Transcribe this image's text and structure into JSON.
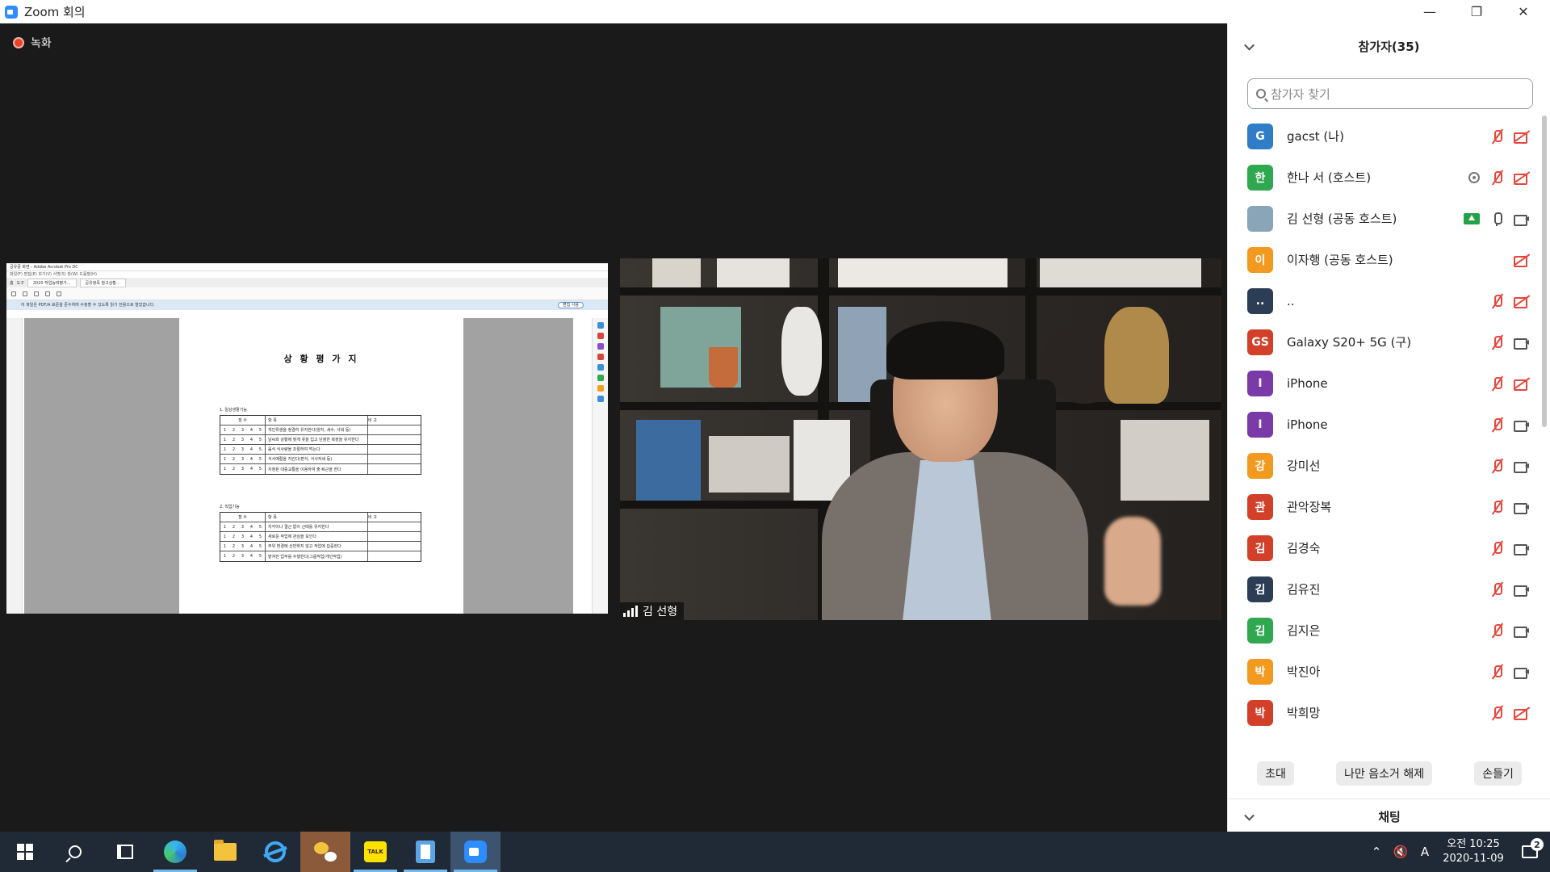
{
  "window": {
    "title": "Zoom 회의",
    "minimize_icon": "minimize-icon",
    "restore_icon": "restore-icon",
    "close_icon": "close-icon"
  },
  "meeting": {
    "recording_label": "녹화",
    "shared_document": {
      "title": "상 황 평 가 지",
      "titlebar": "공유중 화면 - Adobe Acrobat Pro DC",
      "menu": "파일(F)  편집(E)  보기(V)  서명(S)  창(W)  도움말(H)",
      "tabs": [
        "홈",
        "도구",
        "2020 작업능력평가...",
        "공유정목 참고상황..."
      ],
      "notice": "이 파일은 PDF/A 표준을 준수하며 수정할 수 있도록 읽기 전용으로 열었습니다.",
      "notice_button": "편집 사용",
      "section1": "1. 일상생활기능",
      "section2": "2. 직업기능",
      "section1_items": [
        "개인위생을 청결히 유지한다(양치, 세수, 샤워 등)",
        "날씨와 상황에 맞게 옷을 입고 단정한 복장을 유지한다",
        "음식 식사량을 조절하여 먹는다",
        "식사예절을 지킨다(편식, 식사자세 등)",
        "지정된 대중교통을 이용하여 출·퇴근을 한다"
      ],
      "section2_items": [
        "지각이나 결근 없이 근태를 유지한다",
        "새로운 작업에 관심을 보인다",
        "주위 환경에 산만하지 않고 작업에 집중한다",
        "맡겨진 업무를 수행한다(그룹작업/개인작업)"
      ],
      "column_headers": [
        "점 수",
        "항 목",
        "비 고"
      ],
      "score_numbers": [
        "1",
        "2",
        "3",
        "4",
        "5"
      ]
    },
    "speaker": {
      "name": "김 선형"
    }
  },
  "participants_panel": {
    "title": "참가자(35)",
    "search_placeholder": "참가자 찾기",
    "participants": [
      {
        "initial": "G",
        "name": "gacst (나)",
        "color": "#2f7dc7",
        "mic": "off",
        "cam": "off"
      },
      {
        "initial": "한",
        "name": "한나 서 (호스트)",
        "color": "#2fa84f",
        "mic": "off",
        "cam": "off",
        "recording": true
      },
      {
        "initial": "",
        "name": "김 선형 (공동 호스트)",
        "color": "#8aa4b8",
        "mic": "on",
        "cam": "on",
        "sharing": true
      },
      {
        "initial": "이",
        "name": "이자행 (공동 호스트)",
        "color": "#f19a1f",
        "mic": "none",
        "cam": "off"
      },
      {
        "initial": "..",
        "name": "..",
        "color": "#2c3e56",
        "mic": "off",
        "cam": "off"
      },
      {
        "initial": "GS",
        "name": "Galaxy S20+ 5G (구)",
        "color": "#d2402a",
        "mic": "off",
        "cam": "on"
      },
      {
        "initial": "I",
        "name": "iPhone",
        "color": "#7a3aa8",
        "mic": "off",
        "cam": "off"
      },
      {
        "initial": "I",
        "name": "iPhone",
        "color": "#7a3aa8",
        "mic": "off",
        "cam": "on"
      },
      {
        "initial": "강",
        "name": "강미선",
        "color": "#f19a1f",
        "mic": "off",
        "cam": "on"
      },
      {
        "initial": "관",
        "name": "관악장복",
        "color": "#d2402a",
        "mic": "off",
        "cam": "on"
      },
      {
        "initial": "김",
        "name": "김경숙",
        "color": "#d2402a",
        "mic": "off",
        "cam": "on"
      },
      {
        "initial": "김",
        "name": "김유진",
        "color": "#2c3e56",
        "mic": "off",
        "cam": "on"
      },
      {
        "initial": "김",
        "name": "김지은",
        "color": "#2fa84f",
        "mic": "off",
        "cam": "on"
      },
      {
        "initial": "박",
        "name": "박진아",
        "color": "#f19a1f",
        "mic": "off",
        "cam": "on"
      },
      {
        "initial": "박",
        "name": "박희망",
        "color": "#d2402a",
        "mic": "off",
        "cam": "off"
      }
    ],
    "buttons": {
      "invite": "초대",
      "unmute_me": "나만 음소거 해제",
      "raise_hand": "손들기"
    },
    "chat_title": "채팅"
  },
  "taskbar": {
    "apps": [
      "start-icon",
      "search-icon",
      "task-view-icon",
      "edge-icon",
      "file-explorer-icon",
      "internet-explorer-icon",
      "wechat-icon",
      "kakaotalk-icon",
      "document-app-icon",
      "zoom-icon"
    ],
    "kakao_label": "TALK",
    "ime_label": "A",
    "clock_time": "오전 10:25",
    "clock_date": "2020-11-09",
    "notification_count": "2"
  }
}
